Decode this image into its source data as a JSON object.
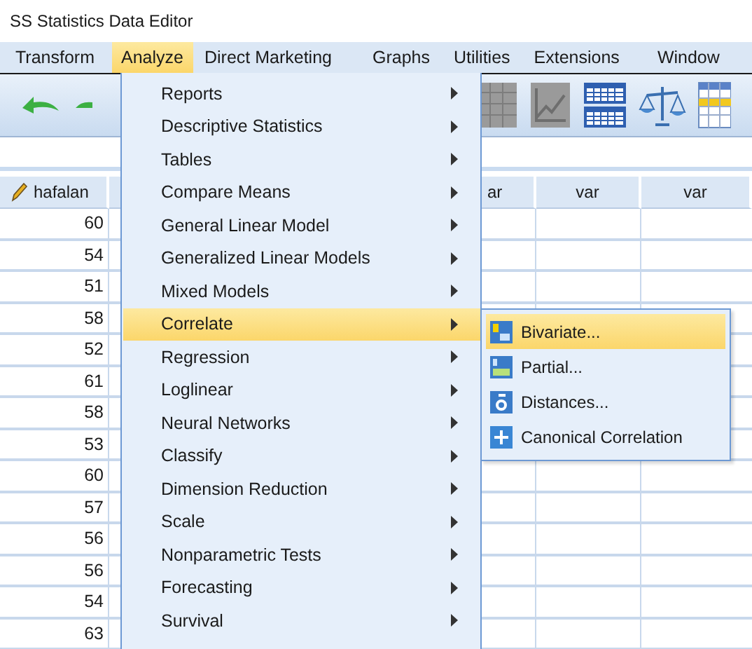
{
  "window": {
    "title": "SS Statistics Data Editor"
  },
  "menu_bar": [
    {
      "label": "Transform",
      "selected": false
    },
    {
      "label": "Analyze",
      "selected": true
    },
    {
      "label": "Direct Marketing",
      "selected": false
    },
    {
      "label": "Graphs",
      "selected": false
    },
    {
      "label": "Utilities",
      "selected": false
    },
    {
      "label": "Extensions",
      "selected": false
    },
    {
      "label": "Window",
      "selected": false
    }
  ],
  "grid": {
    "columns": [
      "hafalan",
      "ar",
      "var",
      "var"
    ],
    "rows": [
      "60",
      "54",
      "51",
      "58",
      "52",
      "61",
      "58",
      "53",
      "60",
      "57",
      "56",
      "56",
      "54",
      "63"
    ]
  },
  "analyze_menu": [
    {
      "label": "Reports",
      "selected": false
    },
    {
      "label": "Descriptive Statistics",
      "selected": false
    },
    {
      "label": "Tables",
      "selected": false
    },
    {
      "label": "Compare Means",
      "selected": false
    },
    {
      "label": "General Linear Model",
      "selected": false
    },
    {
      "label": "Generalized Linear Models",
      "selected": false
    },
    {
      "label": "Mixed Models",
      "selected": false
    },
    {
      "label": "Correlate",
      "selected": true
    },
    {
      "label": "Regression",
      "selected": false
    },
    {
      "label": "Loglinear",
      "selected": false
    },
    {
      "label": "Neural Networks",
      "selected": false
    },
    {
      "label": "Classify",
      "selected": false
    },
    {
      "label": "Dimension Reduction",
      "selected": false
    },
    {
      "label": "Scale",
      "selected": false
    },
    {
      "label": "Nonparametric Tests",
      "selected": false
    },
    {
      "label": "Forecasting",
      "selected": false
    },
    {
      "label": "Survival",
      "selected": false
    }
  ],
  "correlate_submenu": [
    {
      "label": "Bivariate...",
      "kind": "bivariate",
      "selected": true
    },
    {
      "label": "Partial...",
      "kind": "partial",
      "selected": false
    },
    {
      "label": "Distances...",
      "kind": "distances",
      "selected": false
    },
    {
      "label": "Canonical Correlation",
      "kind": "canonical",
      "selected": false
    }
  ]
}
